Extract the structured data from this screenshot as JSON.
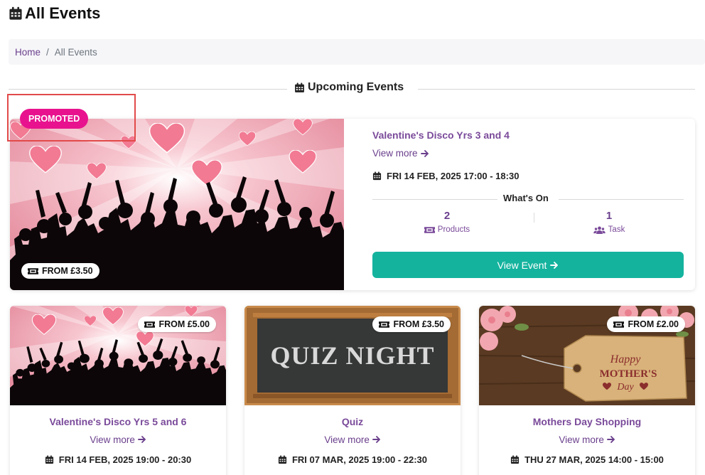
{
  "page": {
    "title": "All Events"
  },
  "breadcrumb": {
    "home": "Home",
    "separator": "/",
    "current": "All Events"
  },
  "section": {
    "title": "Upcoming Events"
  },
  "colors": {
    "accent_purple": "#7a4a9a",
    "promoted_pink": "#e8128e",
    "button_teal": "#14b39e",
    "highlight_red": "#e24a4a"
  },
  "featured": {
    "badge": "PROMOTED",
    "price": "FROM £3.50",
    "title": "Valentine's Disco Yrs 3 and 4",
    "view_more": "View more",
    "date": "FRI 14 FEB, 2025 17:00 - 18:30",
    "whats_on": "What's On",
    "products_count": "2",
    "products_label": "Products",
    "task_count": "1",
    "task_label": "Task",
    "button": "View Event",
    "image_icon": "valentines-disco-image"
  },
  "cards": [
    {
      "title": "Valentine's Disco Yrs 5 and 6",
      "price": "FROM £5.00",
      "view_more": "View more",
      "date": "FRI 14 FEB, 2025 19:00 - 20:30",
      "image_icon": "valentines-disco-image"
    },
    {
      "title": "Quiz",
      "price": "FROM £3.50",
      "view_more": "View more",
      "date": "FRI 07 MAR, 2025 19:00 - 22:30",
      "image_icon": "quiz-night-chalkboard-image",
      "image_text": "QUIZ NIGHT"
    },
    {
      "title": "Mothers Day Shopping",
      "price": "FROM £2.00",
      "view_more": "View more",
      "date": "THU 27 MAR, 2025 14:00 - 15:00",
      "image_icon": "mothers-day-tag-image",
      "image_text_1": "Happy",
      "image_text_2": "MOTHER'S",
      "image_text_3": "Day"
    }
  ]
}
